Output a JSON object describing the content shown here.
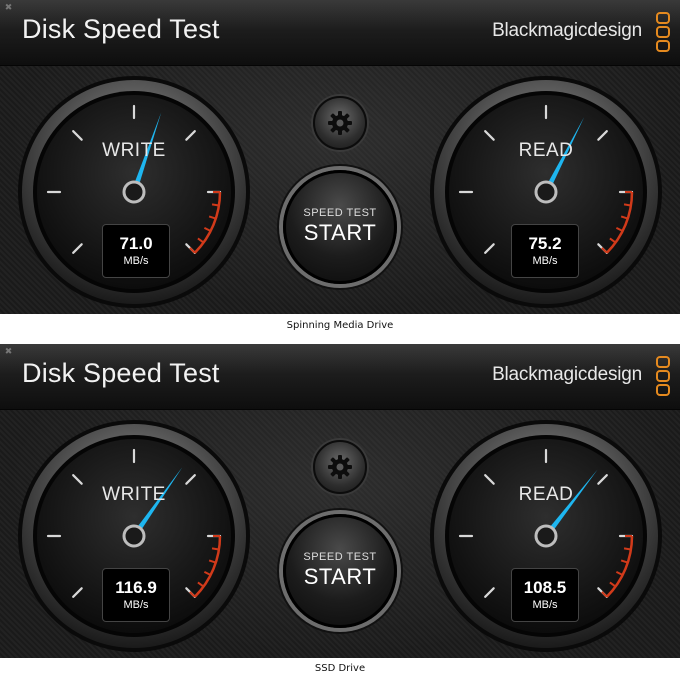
{
  "colors": {
    "accent_blue": "#1eb6f0",
    "redline": "#d13a1a",
    "brand_orange": "#e58a1f"
  },
  "icons": {
    "settings": "gear-icon",
    "close": "close-icon",
    "logo": "blackmagic-logo"
  },
  "panels": [
    {
      "title": "Disk Speed Test",
      "brand": "Blackmagicdesign",
      "write": {
        "label": "WRITE",
        "value": "71.0",
        "unit": "MB/s",
        "level": 0.57
      },
      "read": {
        "label": "READ",
        "value": "75.2",
        "unit": "MB/s",
        "level": 0.6
      },
      "start_button": {
        "line1": "SPEED TEST",
        "line2": "START"
      },
      "caption": "Spinning Media Drive"
    },
    {
      "title": "Disk Speed Test",
      "brand": "Blackmagicdesign",
      "write": {
        "label": "WRITE",
        "value": "116.9",
        "unit": "MB/s",
        "level": 0.63
      },
      "read": {
        "label": "READ",
        "value": "108.5",
        "unit": "MB/s",
        "level": 0.64
      },
      "start_button": {
        "line1": "SPEED TEST",
        "line2": "START"
      },
      "caption": "SSD Drive"
    }
  ]
}
